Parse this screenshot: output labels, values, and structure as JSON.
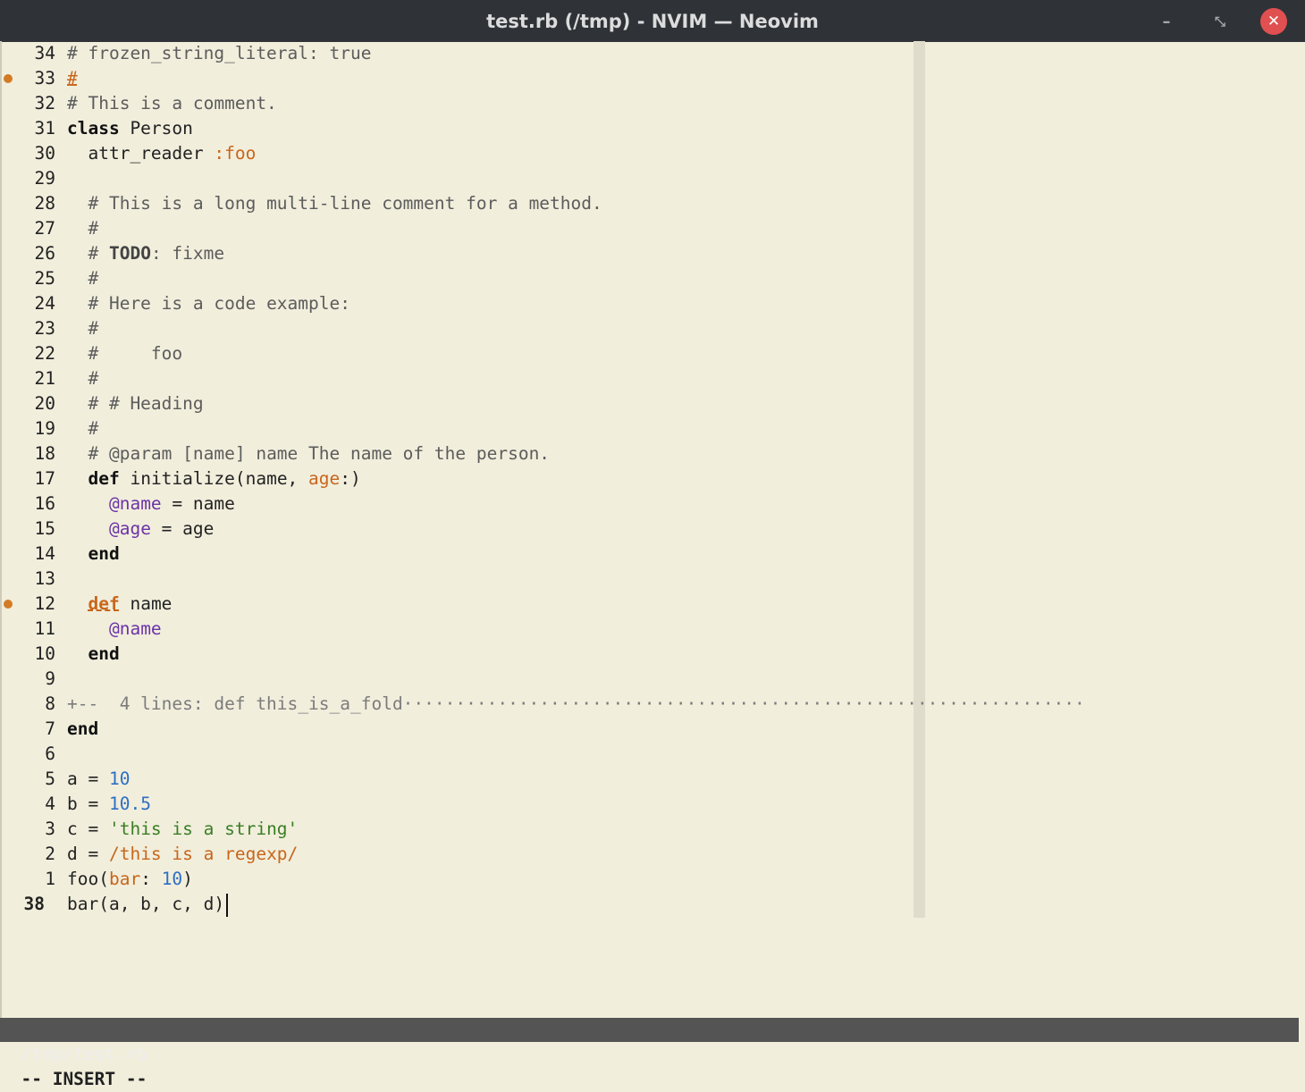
{
  "window": {
    "title": "test.rb (/tmp) - NVIM — Neovim",
    "minimize_glyph": "–",
    "maximize_glyph": "⤡",
    "close_glyph": "✕"
  },
  "buffer": {
    "lines": [
      {
        "num": "34",
        "tokens": [
          {
            "t": "# frozen_string_literal: true",
            "c": "cmt"
          }
        ]
      },
      {
        "num": "33",
        "sign": true,
        "tokens": [
          {
            "t": "#",
            "c": "cmt err"
          }
        ]
      },
      {
        "num": "32",
        "tokens": [
          {
            "t": "# This is a comment.",
            "c": "cmt"
          }
        ]
      },
      {
        "num": "31",
        "tokens": [
          {
            "t": "class",
            "c": "kw"
          },
          {
            "t": " Person"
          }
        ]
      },
      {
        "num": "30",
        "tokens": [
          {
            "t": "  attr_reader "
          },
          {
            "t": ":foo",
            "c": "sym"
          }
        ]
      },
      {
        "num": "29",
        "tokens": []
      },
      {
        "num": "28",
        "tokens": [
          {
            "t": "  "
          },
          {
            "t": "# This is a long multi-line comment for a method.",
            "c": "cmt"
          }
        ]
      },
      {
        "num": "27",
        "tokens": [
          {
            "t": "  "
          },
          {
            "t": "#",
            "c": "cmt"
          }
        ]
      },
      {
        "num": "26",
        "tokens": [
          {
            "t": "  "
          },
          {
            "t": "# ",
            "c": "cmt"
          },
          {
            "t": "TODO",
            "c": "todo"
          },
          {
            "t": ": fixme",
            "c": "cmt"
          }
        ]
      },
      {
        "num": "25",
        "tokens": [
          {
            "t": "  "
          },
          {
            "t": "#",
            "c": "cmt"
          }
        ]
      },
      {
        "num": "24",
        "tokens": [
          {
            "t": "  "
          },
          {
            "t": "# Here is a code example:",
            "c": "cmt"
          }
        ]
      },
      {
        "num": "23",
        "tokens": [
          {
            "t": "  "
          },
          {
            "t": "#",
            "c": "cmt"
          }
        ]
      },
      {
        "num": "22",
        "tokens": [
          {
            "t": "  "
          },
          {
            "t": "#     foo",
            "c": "cmt"
          }
        ]
      },
      {
        "num": "21",
        "tokens": [
          {
            "t": "  "
          },
          {
            "t": "#",
            "c": "cmt"
          }
        ]
      },
      {
        "num": "20",
        "tokens": [
          {
            "t": "  "
          },
          {
            "t": "# # Heading",
            "c": "cmt"
          }
        ]
      },
      {
        "num": "19",
        "tokens": [
          {
            "t": "  "
          },
          {
            "t": "#",
            "c": "cmt"
          }
        ]
      },
      {
        "num": "18",
        "tokens": [
          {
            "t": "  "
          },
          {
            "t": "# @param [name] name The name of the person.",
            "c": "cmt"
          }
        ]
      },
      {
        "num": "17",
        "tokens": [
          {
            "t": "  "
          },
          {
            "t": "def",
            "c": "kw"
          },
          {
            "t": " initialize(name, "
          },
          {
            "t": "age",
            "c": "sym"
          },
          {
            "t": ":)"
          }
        ]
      },
      {
        "num": "16",
        "tokens": [
          {
            "t": "    "
          },
          {
            "t": "@name",
            "c": "ivar"
          },
          {
            "t": " = name"
          }
        ]
      },
      {
        "num": "15",
        "tokens": [
          {
            "t": "    "
          },
          {
            "t": "@age",
            "c": "ivar"
          },
          {
            "t": " = age"
          }
        ]
      },
      {
        "num": "14",
        "tokens": [
          {
            "t": "  "
          },
          {
            "t": "end",
            "c": "kw"
          }
        ]
      },
      {
        "num": "13",
        "tokens": []
      },
      {
        "num": "12",
        "sign": true,
        "tokens": [
          {
            "t": "  "
          },
          {
            "t": "def",
            "c": "kw err"
          },
          {
            "t": " name"
          }
        ]
      },
      {
        "num": "11",
        "tokens": [
          {
            "t": "    "
          },
          {
            "t": "@name",
            "c": "ivar"
          }
        ]
      },
      {
        "num": "10",
        "tokens": [
          {
            "t": "  "
          },
          {
            "t": "end",
            "c": "kw"
          }
        ]
      },
      {
        "num": "9",
        "tokens": []
      },
      {
        "num": "8",
        "fold": true,
        "tokens": [
          {
            "t": "+--  4 lines: def this_is_a_fold·································································",
            "c": "fold"
          }
        ]
      },
      {
        "num": "7",
        "tokens": [
          {
            "t": "end",
            "c": "kw"
          }
        ]
      },
      {
        "num": "6",
        "tokens": []
      },
      {
        "num": "5",
        "tokens": [
          {
            "t": "a = "
          },
          {
            "t": "10",
            "c": "num"
          }
        ]
      },
      {
        "num": "4",
        "tokens": [
          {
            "t": "b = "
          },
          {
            "t": "10.5",
            "c": "num"
          }
        ]
      },
      {
        "num": "3",
        "tokens": [
          {
            "t": "c = "
          },
          {
            "t": "'this is a string'",
            "c": "str"
          }
        ]
      },
      {
        "num": "2",
        "tokens": [
          {
            "t": "d = "
          },
          {
            "t": "/this is a regexp/",
            "c": "rgx"
          }
        ]
      },
      {
        "num": "1",
        "tokens": [
          {
            "t": "foo("
          },
          {
            "t": "bar",
            "c": "sym"
          },
          {
            "t": ": "
          },
          {
            "t": "10",
            "c": "num"
          },
          {
            "t": ")"
          }
        ]
      },
      {
        "num": "38",
        "current": true,
        "cursor": true,
        "tokens": [
          {
            "t": "bar(a, b, c, d)"
          }
        ]
      }
    ]
  },
  "statusline": {
    "filename": "/tmp/test.rb"
  },
  "cmdline": {
    "mode": "-- INSERT --"
  },
  "colors": {
    "background": "#f1eedc",
    "titlebar": "#2f3338",
    "statusline": "#545454",
    "sign": "#d27b25",
    "close_button": "#e05050"
  }
}
